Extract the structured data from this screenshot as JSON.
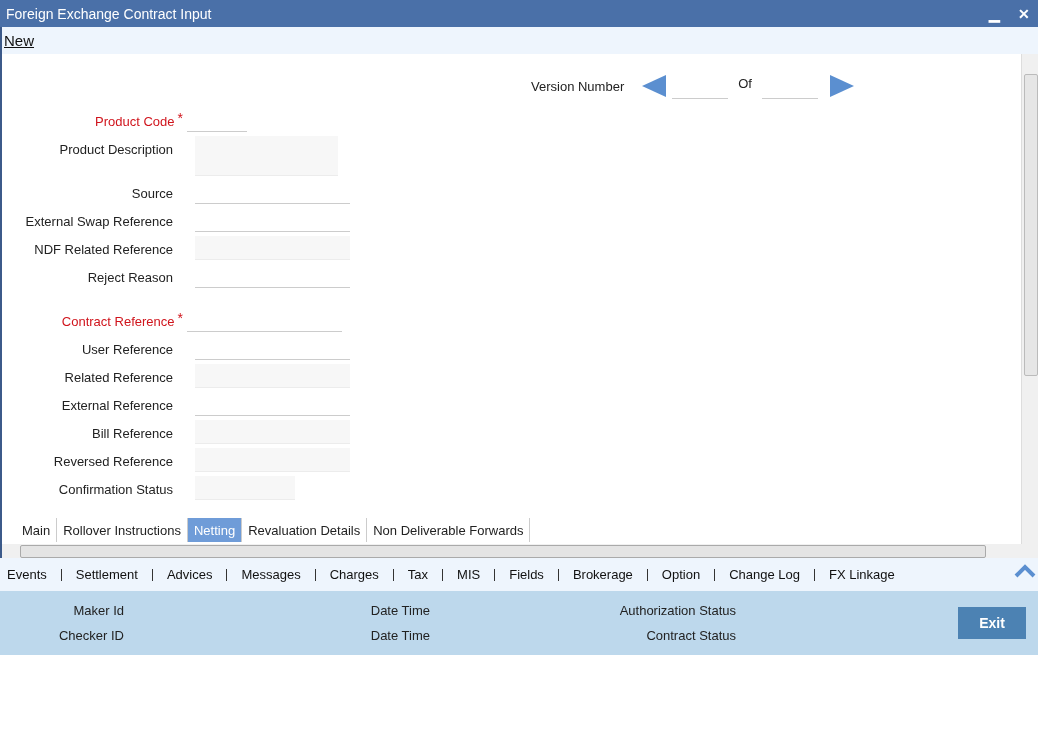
{
  "window": {
    "title": "Foreign Exchange Contract Input",
    "controls": [
      "▁",
      "✕"
    ]
  },
  "menu": {
    "items": [
      "New"
    ]
  },
  "version": {
    "label": "Version Number",
    "of_label": "Of"
  },
  "field_groups": [
    [
      {
        "label": "Product Code",
        "marker": "*",
        "kind": "short-input"
      },
      {
        "label": "Product Description",
        "kind": "textarea"
      },
      {
        "label": "Source",
        "kind": "input"
      },
      {
        "label": "External Swap Reference",
        "kind": "input"
      },
      {
        "label": "NDF Related Reference",
        "kind": "readonly"
      },
      {
        "label": "Reject Reason",
        "kind": "input"
      }
    ],
    [
      {
        "label": "Contract Reference",
        "marker": "*",
        "kind": "input"
      },
      {
        "label": "User Reference",
        "kind": "input"
      },
      {
        "label": "Related Reference",
        "kind": "readonly"
      },
      {
        "label": "External Reference",
        "kind": "input"
      },
      {
        "label": "Bill Reference",
        "kind": "readonly"
      },
      {
        "label": "Reversed Reference",
        "kind": "readonly"
      },
      {
        "label": "Confirmation Status",
        "kind": "short-readonly"
      }
    ]
  ],
  "tabs": [
    {
      "label": "Main",
      "selected": false
    },
    {
      "label": "Rollover Instructions",
      "selected": false
    },
    {
      "label": "Netting",
      "selected": true
    },
    {
      "label": "Revaluation Details",
      "selected": false
    },
    {
      "label": "Non Deliverable Forwards",
      "selected": false
    }
  ],
  "links": [
    "Events",
    "Settlement",
    "Advices",
    "Messages",
    "Charges",
    "Tax",
    "MIS",
    "Fields",
    "Brokerage",
    "Option",
    "Change Log",
    "FX Linkage"
  ],
  "audit": {
    "rows": [
      [
        "Maker Id",
        "Date Time",
        "Authorization Status"
      ],
      [
        "Checker ID",
        "Date Time",
        "Contract Status"
      ]
    ],
    "button": "Exit"
  }
}
